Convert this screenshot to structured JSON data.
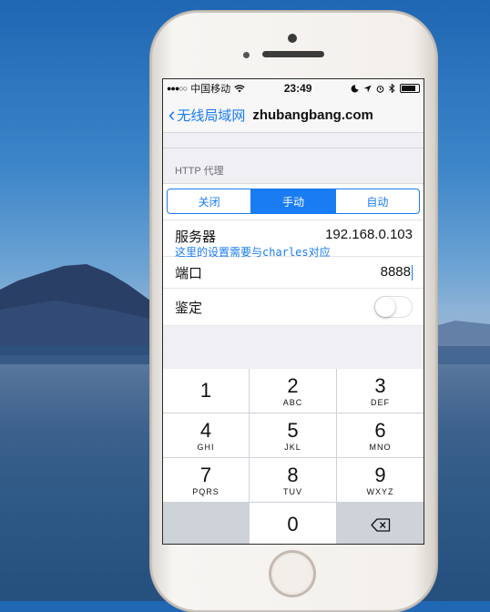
{
  "status_bar": {
    "signal": "●●●○○",
    "carrier": "中国移动",
    "wifi_icon": "wifi-icon",
    "time": "23:49",
    "right_icons": [
      "moon-icon",
      "location-icon",
      "alarm-icon",
      "bluetooth-icon",
      "battery-icon"
    ]
  },
  "nav": {
    "back_label": "无线局域网",
    "title": "zhubangbang.com"
  },
  "http_proxy": {
    "header": "HTTP 代理",
    "segments": [
      {
        "label": "关闭",
        "active": false
      },
      {
        "label": "手动",
        "active": true
      },
      {
        "label": "自动",
        "active": false
      }
    ],
    "server_label": "服务器",
    "server_value": "192.168.0.103",
    "annotation": "这里的设置需要与charles对应",
    "port_label": "端口",
    "port_value": "8888",
    "auth_label": "鉴定",
    "auth_on": false
  },
  "keypad": {
    "keys": [
      {
        "digit": "1",
        "letters": ""
      },
      {
        "digit": "2",
        "letters": "ABC"
      },
      {
        "digit": "3",
        "letters": "DEF"
      },
      {
        "digit": "4",
        "letters": "GHI"
      },
      {
        "digit": "5",
        "letters": "JKL"
      },
      {
        "digit": "6",
        "letters": "MNO"
      },
      {
        "digit": "7",
        "letters": "PQRS"
      },
      {
        "digit": "8",
        "letters": "TUV"
      },
      {
        "digit": "9",
        "letters": "WXYZ"
      }
    ],
    "zero": "0",
    "delete_icon": "backspace-icon"
  },
  "colors": {
    "accent": "#1a7cf3",
    "background": "#efeff4"
  }
}
